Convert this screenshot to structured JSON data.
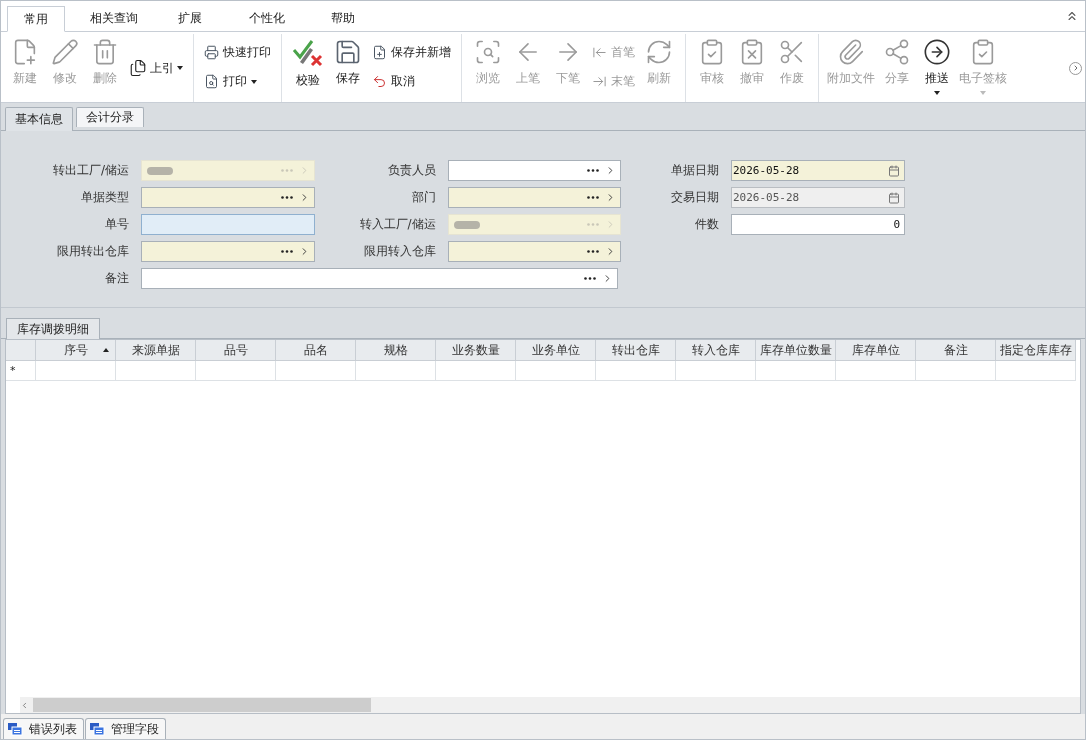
{
  "ribbon_tabs": [
    {
      "label": "常用",
      "selected": true
    },
    {
      "label": "相关查询",
      "selected": false
    },
    {
      "label": "扩展",
      "selected": false
    },
    {
      "label": "个性化",
      "selected": false
    },
    {
      "label": "帮助",
      "selected": false
    }
  ],
  "toolbar": [
    {
      "kind": "large",
      "label": "新建",
      "disabled": true
    },
    {
      "kind": "large",
      "label": "修改",
      "disabled": true
    },
    {
      "kind": "large",
      "label": "删除",
      "disabled": true
    },
    {
      "kind": "dropdown",
      "label": "上引",
      "disabled": false
    },
    {
      "kind": "separator"
    },
    {
      "kind": "stack",
      "items": [
        {
          "label": "快速打印",
          "disabled": false,
          "caret": false
        },
        {
          "label": "打印",
          "disabled": false,
          "caret": true
        }
      ]
    },
    {
      "kind": "separator"
    },
    {
      "kind": "large",
      "label": "校验",
      "disabled": false
    },
    {
      "kind": "large",
      "label": "保存",
      "disabled": false
    },
    {
      "kind": "stack",
      "items": [
        {
          "label": "保存并新增",
          "disabled": false,
          "caret": false
        },
        {
          "label": "取消",
          "disabled": false,
          "caret": false
        }
      ]
    },
    {
      "kind": "separator"
    },
    {
      "kind": "large",
      "label": "浏览",
      "disabled": true
    },
    {
      "kind": "large",
      "label": "上笔",
      "disabled": true
    },
    {
      "kind": "large",
      "label": "下笔",
      "disabled": true
    },
    {
      "kind": "stack",
      "items": [
        {
          "label": "首笔",
          "disabled": true,
          "caret": false
        },
        {
          "label": "末笔",
          "disabled": true,
          "caret": false
        }
      ]
    },
    {
      "kind": "large",
      "label": "刷新",
      "disabled": true
    },
    {
      "kind": "separator"
    },
    {
      "kind": "large",
      "label": "审核",
      "disabled": true
    },
    {
      "kind": "large",
      "label": "撤审",
      "disabled": true
    },
    {
      "kind": "large",
      "label": "作废",
      "disabled": true
    },
    {
      "kind": "separator"
    },
    {
      "kind": "large",
      "label": "附加文件",
      "disabled": true
    },
    {
      "kind": "large",
      "label": "分享",
      "disabled": true
    },
    {
      "kind": "large",
      "label": "推送",
      "disabled": false,
      "caret": true
    },
    {
      "kind": "large",
      "label": "电子签核",
      "disabled": true,
      "caret": true
    }
  ],
  "form_tabs": [
    {
      "label": "基本信息",
      "selected": true
    },
    {
      "label": "会计分录",
      "selected": false
    }
  ],
  "form_columns": [
    [
      {
        "label": "转出工厂/储运",
        "kind": "lookup",
        "required": true,
        "readonly": false,
        "focused": false,
        "blurred": true
      },
      {
        "label": "单据类型",
        "kind": "lookup",
        "required": true,
        "readonly": false,
        "focused": false,
        "blurred": false
      },
      {
        "label": "单号",
        "kind": "text",
        "required": false,
        "readonly": false,
        "focused": true,
        "blurred": false
      },
      {
        "label": "限用转出仓库",
        "kind": "lookup",
        "required": true,
        "readonly": false,
        "focused": false,
        "blurred": false
      }
    ],
    [
      {
        "label": "负责人员",
        "kind": "lookup",
        "required": false,
        "readonly": false,
        "focused": false,
        "blurred": false
      },
      {
        "label": "部门",
        "kind": "lookup",
        "required": true,
        "readonly": false,
        "focused": false,
        "blurred": false
      },
      {
        "label": "转入工厂/储运",
        "kind": "lookup",
        "required": true,
        "readonly": false,
        "focused": false,
        "blurred": true
      },
      {
        "label": "限用转入仓库",
        "kind": "lookup",
        "required": true,
        "readonly": false,
        "focused": false,
        "blurred": false
      }
    ],
    [
      {
        "label": "单据日期",
        "kind": "date",
        "required": true,
        "readonly": false,
        "focused": false,
        "value": "2026-05-28"
      },
      {
        "label": "交易日期",
        "kind": "date",
        "required": false,
        "readonly": true,
        "focused": false,
        "value": "2026-05-28"
      },
      {
        "label": "件数",
        "kind": "number",
        "required": false,
        "readonly": false,
        "focused": false,
        "value": "0"
      }
    ]
  ],
  "remark": {
    "label": "备注",
    "kind": "lookup",
    "required": false,
    "readonly": false,
    "focused": false
  },
  "detail_tab": {
    "label": "库存调拨明细",
    "selected": true
  },
  "grid": {
    "columns": [
      {
        "label": "序号",
        "sorted": true
      },
      {
        "label": "来源单据",
        "sorted": false
      },
      {
        "label": "品号",
        "sorted": false
      },
      {
        "label": "品名",
        "sorted": false
      },
      {
        "label": "规格",
        "sorted": false
      },
      {
        "label": "业务数量",
        "sorted": false
      },
      {
        "label": "业务单位",
        "sorted": false
      },
      {
        "label": "转出仓库",
        "sorted": false
      },
      {
        "label": "转入仓库",
        "sorted": false
      },
      {
        "label": "库存单位数量",
        "sorted": false
      },
      {
        "label": "库存单位",
        "sorted": false
      },
      {
        "label": "备注",
        "sorted": false
      },
      {
        "label": "指定仓库库存",
        "sorted": false
      }
    ],
    "new_row_marker": "*"
  },
  "bottom_tabs": [
    {
      "label": "错误列表"
    },
    {
      "label": "管理字段"
    }
  ]
}
